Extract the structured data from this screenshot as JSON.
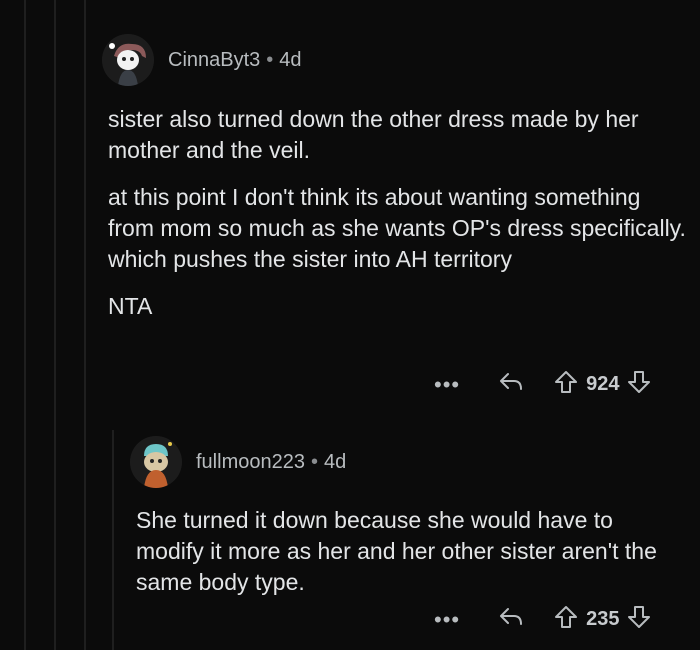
{
  "comments": [
    {
      "username": "CinnaByt3",
      "separator": "•",
      "age": "4d",
      "paragraphs": [
        "sister also turned down the other dress made by her mother and the veil.",
        "at this point I don't think its about wanting something from mom so much as she wants OP's dress specifically. which pushes the sister into AH territory",
        "NTA"
      ],
      "score": "924",
      "more": "•••"
    },
    {
      "username": "fullmoon223",
      "separator": "•",
      "age": "4d",
      "paragraphs": [
        "She turned it down because  she would have to modify it more as her and her other sister aren't the same body type."
      ],
      "score": "235",
      "more": "•••"
    }
  ],
  "icons": {
    "reply": "reply-icon",
    "upvote": "upvote-icon",
    "downvote": "downvote-icon",
    "more": "more-options-icon"
  }
}
